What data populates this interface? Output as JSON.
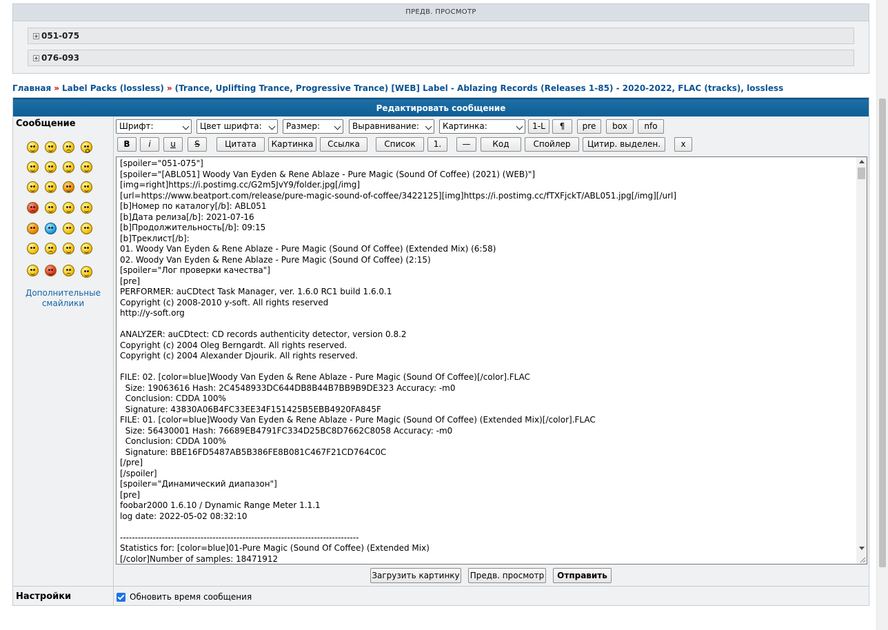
{
  "preview": {
    "title": "ПРЕДВ. ПРОСМОТР",
    "spoilers": [
      "051-075",
      "076-093"
    ]
  },
  "breadcrumb": {
    "home": "Главная",
    "separator": "»",
    "category": "Label Packs (lossless)",
    "topic": "(Trance, Uplifting Trance, Progressive Trance) [WEB] Label - Ablazing Records (Releases 1-85) - 2020-2022, FLAC (tracks), lossless"
  },
  "editor": {
    "header": "Редактировать сообщение",
    "message_label": "Сообщение",
    "more_smiles": "Дополнительные смайлики",
    "settings_label": "Настройки",
    "update_time_label": "Обновить время сообщения",
    "update_time_checked": true
  },
  "toolbar": {
    "font": "Шрифт:",
    "font_color": "Цвет шрифта:",
    "size": "Размер:",
    "align": "Выравнивание:",
    "picture_select": "Картинка:",
    "btn_1l": "1-L",
    "btn_para": "¶",
    "btn_pre": "pre",
    "btn_box": "box",
    "btn_nfo": "nfo",
    "btn_b": "B",
    "btn_i": "i",
    "btn_u": "u",
    "btn_s": "S",
    "btn_quote": "Цитата",
    "btn_picture": "Картинка",
    "btn_link": "Ссылка",
    "btn_list": "Список",
    "btn_num": "1.",
    "btn_hr": "—",
    "btn_code": "Код",
    "btn_spoiler": "Спойлер",
    "btn_quote_sel": "Цитир. выделен.",
    "btn_close": "x"
  },
  "message_text": "[spoiler=\"051-075\"]\n[spoiler=\"[ABL051] Woody Van Eyden & Rene Ablaze - Pure Magic (Sound Of Coffee) (2021) (WEB)\"]\n[img=right]https://i.postimg.cc/G2m5JvY9/folder.jpg[/img]\n[url=https://www.beatport.com/release/pure-magic-sound-of-coffee/3422125][img]https://i.postimg.cc/fTXFjckT/ABL051.jpg[/img][/url]\n[b]Номер по каталогу[/b]: ABL051\n[b]Дата релиза[/b]: 2021-07-16\n[b]Продолжительность[/b]: 09:15\n[b]Треклист[/b]:\n01. Woody Van Eyden & Rene Ablaze - Pure Magic (Sound Of Coffee) (Extended Mix) (6:58)\n02. Woody Van Eyden & Rene Ablaze - Pure Magic (Sound Of Coffee) (2:15)\n[spoiler=\"Лог проверки качества\"]\n[pre]\nPERFORMER: auCDtect Task Manager, ver. 1.6.0 RC1 build 1.6.0.1\nCopyright (c) 2008-2010 y-soft. All rights reserved\nhttp://y-soft.org\n\nANALYZER: auCDtect: CD records authenticity detector, version 0.8.2\nCopyright (c) 2004 Oleg Berngardt. All rights reserved.\nCopyright (c) 2004 Alexander Djourik. All rights reserved.\n\nFILE: 02. [color=blue]Woody Van Eyden & Rene Ablaze - Pure Magic (Sound Of Coffee)[/color].FLAC\n  Size: 19063616 Hash: 2C4548933DC644DB8B44B7BB9B9DE323 Accuracy: -m0\n  Conclusion: CDDA 100%\n  Signature: 43830A06B4FC33EE34F151425B5EBB4920FA845F\nFILE: 01. [color=blue]Woody Van Eyden & Rene Ablaze - Pure Magic (Sound Of Coffee) (Extended Mix)[/color].FLAC\n  Size: 56430001 Hash: 76689EB4791FC334D25BC8D7662C8058 Accuracy: -m0\n  Conclusion: CDDA 100%\n  Signature: BBE16FD5487AB5B386FE8B081C467F21CD764C0C\n[/pre]\n[/spoiler]\n[spoiler=\"Динамический диапазон\"]\n[pre]\nfoobar2000 1.6.10 / Dynamic Range Meter 1.1.1\nlog date: 2022-05-02 08:32:10\n\n--------------------------------------------------------------------------------\nStatistics for: [color=blue]01-Pure Magic (Sound Of Coffee) (Extended Mix)\n[/color]Number of samples: 18471912",
  "actions": {
    "upload": "Загрузить картинку",
    "preview": "Предв. просмотр",
    "submit": "Отправить"
  }
}
